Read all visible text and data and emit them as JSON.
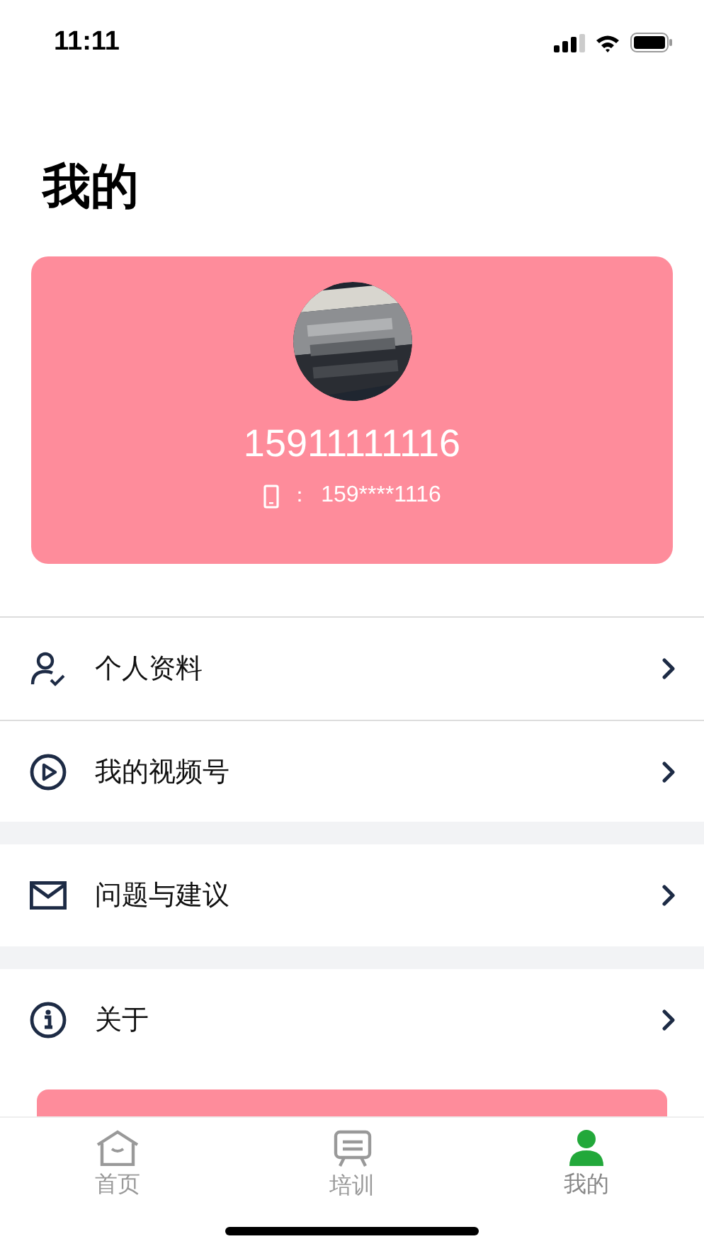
{
  "status_bar": {
    "time": "11:11"
  },
  "title": "我的",
  "profile": {
    "name": "15911111116",
    "phone_separator": "：",
    "phone": "159****1116"
  },
  "menu_groups": [
    {
      "items": [
        {
          "label": "个人资料"
        },
        {
          "label": "我的视频号"
        }
      ]
    },
    {
      "items": [
        {
          "label": "问题与建议"
        }
      ]
    },
    {
      "items": [
        {
          "label": "关于"
        }
      ]
    }
  ],
  "tab_bar": [
    {
      "label": "首页",
      "selected": false
    },
    {
      "label": "培训",
      "selected": false
    },
    {
      "label": "我的",
      "selected": true
    }
  ]
}
